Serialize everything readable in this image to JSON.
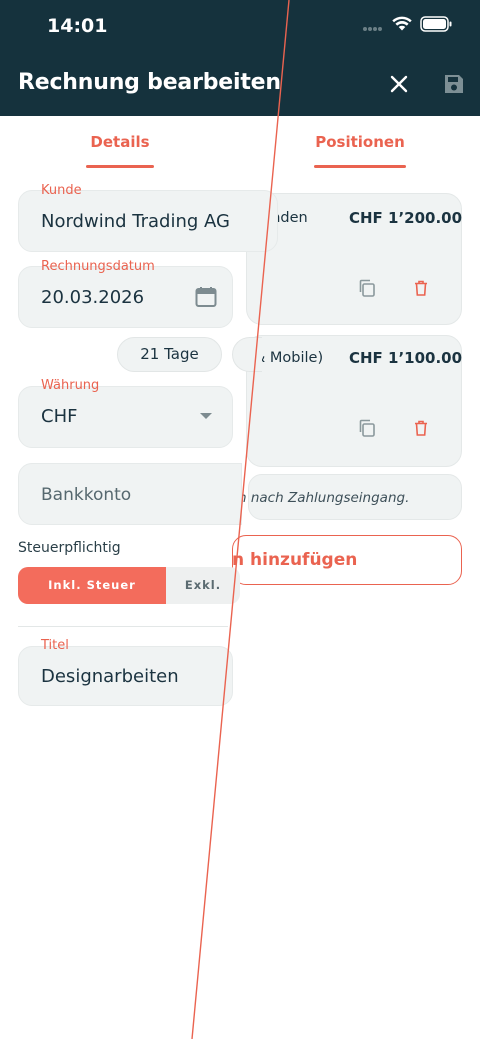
{
  "status_bar": {
    "time": "14:01"
  },
  "header": {
    "title": "Rechnung bearbeiten"
  },
  "tabs": [
    {
      "label": "Details"
    },
    {
      "label": "Positionen"
    }
  ],
  "details": {
    "kunde": {
      "label": "Kunde",
      "value": "Nordwind Trading AG"
    },
    "rechnungsdatum": {
      "label": "Rechnungsdatum",
      "value": "20.03.2026"
    },
    "zahlungsfrist": {
      "value": "21 Tage"
    },
    "waehrung": {
      "label": "Währung",
      "value": "CHF"
    },
    "bankkonto": {
      "placeholder": "Bankkonto"
    },
    "steuerpflichtig": {
      "label": "Steuerpflichtig",
      "options": [
        "Inkl. Steuer",
        "Exkl."
      ],
      "selected": "Inkl. Steuer"
    },
    "titel": {
      "label": "Titel",
      "value": "Designarbeiten"
    }
  },
  "positionen": {
    "items": [
      {
        "name": "unden",
        "amount": "CHF 1’200.00"
      },
      {
        "name": "& Mobile)",
        "amount": "CHF 1’100.00"
      }
    ],
    "note": "n nach Zahlungseingang.",
    "add_label": "n hinzufügen"
  },
  "colors": {
    "header_bg": "#15323d",
    "accent": "#ea6350",
    "field_bg": "#f0f3f3"
  },
  "icons": [
    "wifi-icon",
    "battery-icon",
    "close-icon",
    "save-icon",
    "calendar-icon",
    "dropdown-arrow-icon",
    "copy-icon",
    "delete-icon"
  ]
}
